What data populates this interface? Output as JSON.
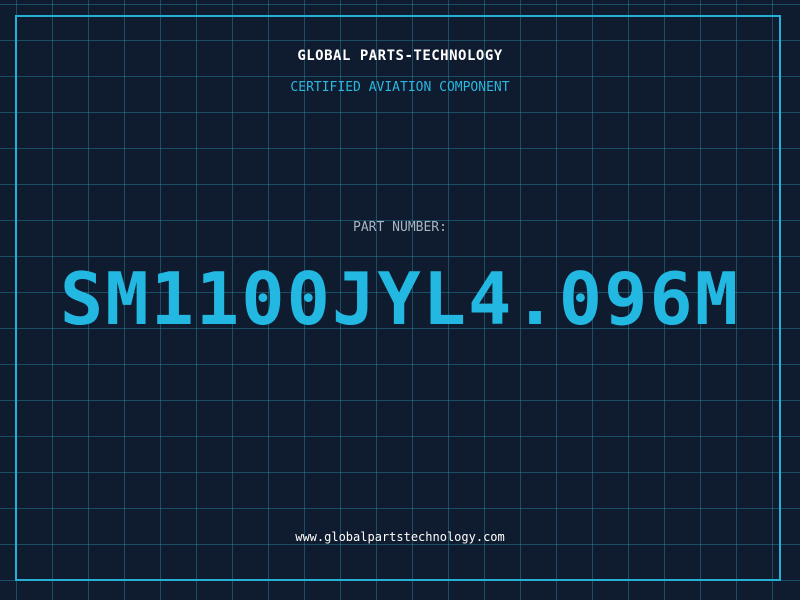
{
  "header": {
    "company": "GLOBAL PARTS-TECHNOLOGY",
    "subtitle": "CERTIFIED AVIATION COMPONENT"
  },
  "part": {
    "label": "PART NUMBER:",
    "number": "SM1100JYL4.096M"
  },
  "footer": {
    "url": "www.globalpartstechnology.com"
  },
  "colors": {
    "background": "#0f1b2e",
    "accent": "#22b8e2",
    "grid": "#288caa",
    "text": "#ffffff"
  }
}
